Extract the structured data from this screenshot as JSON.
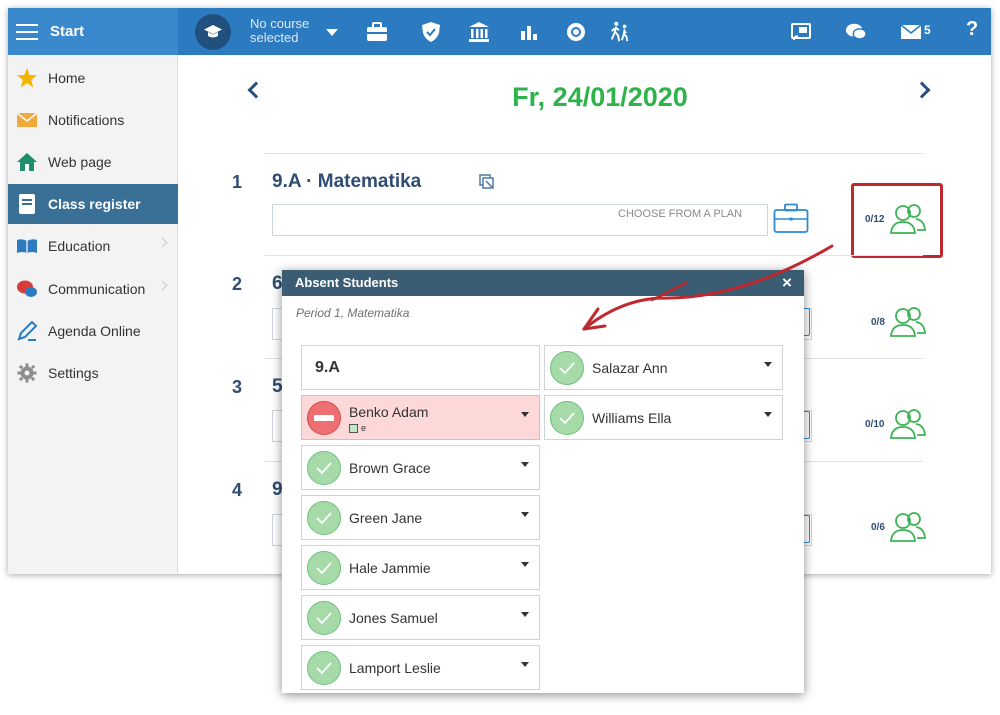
{
  "topbar": {
    "start_label": "Start",
    "course_line1": "No course",
    "course_line2": "selected",
    "messages_count": "5",
    "help_label": "?"
  },
  "sidebar": {
    "items": [
      {
        "label": "Home"
      },
      {
        "label": "Notifications"
      },
      {
        "label": "Web page"
      },
      {
        "label": "Class register"
      },
      {
        "label": "Education"
      },
      {
        "label": "Communication"
      },
      {
        "label": "Agenda Online"
      },
      {
        "label": "Settings"
      }
    ]
  },
  "main": {
    "date": "Fr, 24/01/2020",
    "plan_label": "CHOOSE FROM A PLAN",
    "periods": [
      {
        "number": "1",
        "title": "9.A · Matematika",
        "absent": "0/12"
      },
      {
        "number": "2",
        "title": "6",
        "absent": "0/8"
      },
      {
        "number": "3",
        "title": "5",
        "absent": "0/10"
      },
      {
        "number": "4",
        "title": "9",
        "absent": "0/6"
      }
    ]
  },
  "dialog": {
    "title": "Absent Students",
    "close_label": "×",
    "subtitle": "Period 1, Matematika",
    "class_name": "9.A",
    "students": [
      {
        "name": "Benko Adam",
        "status": "absent",
        "code": "e"
      },
      {
        "name": "Brown Grace",
        "status": "present",
        "code": ""
      },
      {
        "name": "Green Jane",
        "status": "present",
        "code": ""
      },
      {
        "name": "Hale Jammie",
        "status": "present",
        "code": ""
      },
      {
        "name": "Jones Samuel",
        "status": "present",
        "code": ""
      },
      {
        "name": "Lamport Leslie",
        "status": "present",
        "code": ""
      },
      {
        "name": "Salazar Ann",
        "status": "present",
        "code": ""
      },
      {
        "name": "Williams Ella",
        "status": "present",
        "code": ""
      }
    ]
  },
  "colors": {
    "topbar": "#2c7bc0",
    "sidebar_active": "#3a6f96",
    "date_green": "#2db34a",
    "present_green": "#a6dba9",
    "absent_red": "#ee6f72",
    "highlight_red": "#c0282f"
  }
}
